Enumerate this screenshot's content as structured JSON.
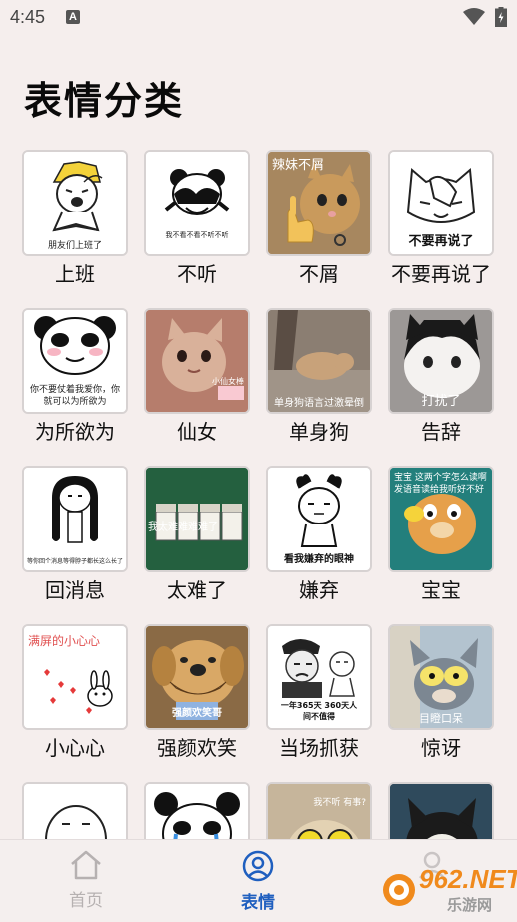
{
  "status_bar": {
    "time": "4:45",
    "notification_icon": "a-badge-icon",
    "wifi_icon": "wifi-icon",
    "battery_icon": "battery-icon"
  },
  "page": {
    "title": "表情分类"
  },
  "categories": [
    {
      "label": "上班",
      "caption": "朋友们上班了"
    },
    {
      "label": "不听",
      "caption": "我不看不看不听不听"
    },
    {
      "label": "不屑",
      "caption": "辣妹不屑"
    },
    {
      "label": "不要再说了",
      "caption": "不要再说了"
    },
    {
      "label": "为所欲为",
      "caption": "你不要仗着我爱你，你就可以为所欲为"
    },
    {
      "label": "仙女",
      "caption": "小仙女棒"
    },
    {
      "label": "单身狗",
      "caption": "单身狗语言过激晕倒"
    },
    {
      "label": "告辞",
      "caption": "打扰了"
    },
    {
      "label": "回消息",
      "caption": "等你回个消息等得脖子都长这么长了"
    },
    {
      "label": "太难了",
      "caption": "我太难难难难了"
    },
    {
      "label": "嫌弃",
      "caption": "看我嫌弃的眼神"
    },
    {
      "label": "宝宝",
      "caption": "宝宝 这两个字怎么读啊 发语音读给我听好不好"
    },
    {
      "label": "小心心",
      "caption": "满屏的小心心"
    },
    {
      "label": "强颜欢笑",
      "caption": "强颜欢笑哥"
    },
    {
      "label": "当场抓获",
      "caption": "一年365天 360天人间不值得"
    },
    {
      "label": "惊讶",
      "caption": "目瞪口呆"
    },
    {
      "label": "",
      "caption": ""
    },
    {
      "label": "",
      "caption": ""
    },
    {
      "label": "",
      "caption": "我不听 有事?"
    },
    {
      "label": "",
      "caption": ""
    }
  ],
  "bottom_nav": {
    "items": [
      {
        "label": "首页",
        "icon": "home-icon",
        "active": false
      },
      {
        "label": "表情",
        "icon": "user-circle-icon",
        "active": true
      },
      {
        "label": "",
        "icon": "profile-icon",
        "active": false
      }
    ]
  },
  "watermark": {
    "brand": "962.NET",
    "sub": "乐游网"
  },
  "colors": {
    "accent": "#1f5fbf",
    "inactive": "#b6b1b1",
    "background": "#f5eeed"
  }
}
